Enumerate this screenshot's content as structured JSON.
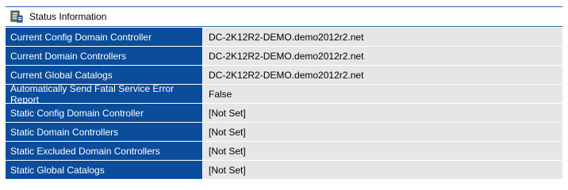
{
  "section": {
    "title": "Status Information",
    "icon": "server-status-icon"
  },
  "rows": [
    {
      "label": "Current Config Domain Controller",
      "value": "DC-2K12R2-DEMO.demo2012r2.net"
    },
    {
      "label": "Current Domain Controllers",
      "value": "DC-2K12R2-DEMO.demo2012r2.net"
    },
    {
      "label": "Current Global Catalogs",
      "value": "DC-2K12R2-DEMO.demo2012r2.net"
    },
    {
      "label": "Automatically Send Fatal Service Error Report",
      "value": "False"
    },
    {
      "label": "Static Config Domain Controller",
      "value": "[Not Set]"
    },
    {
      "label": "Static Domain Controllers",
      "value": "[Not Set]"
    },
    {
      "label": "Static Excluded Domain Controllers",
      "value": "[Not Set]"
    },
    {
      "label": "Static Global Catalogs",
      "value": "[Not Set]"
    }
  ],
  "colors": {
    "label_bg": "#0b4c9b",
    "value_bg": "#e6e6e6",
    "header_border": "#2f63b4"
  }
}
